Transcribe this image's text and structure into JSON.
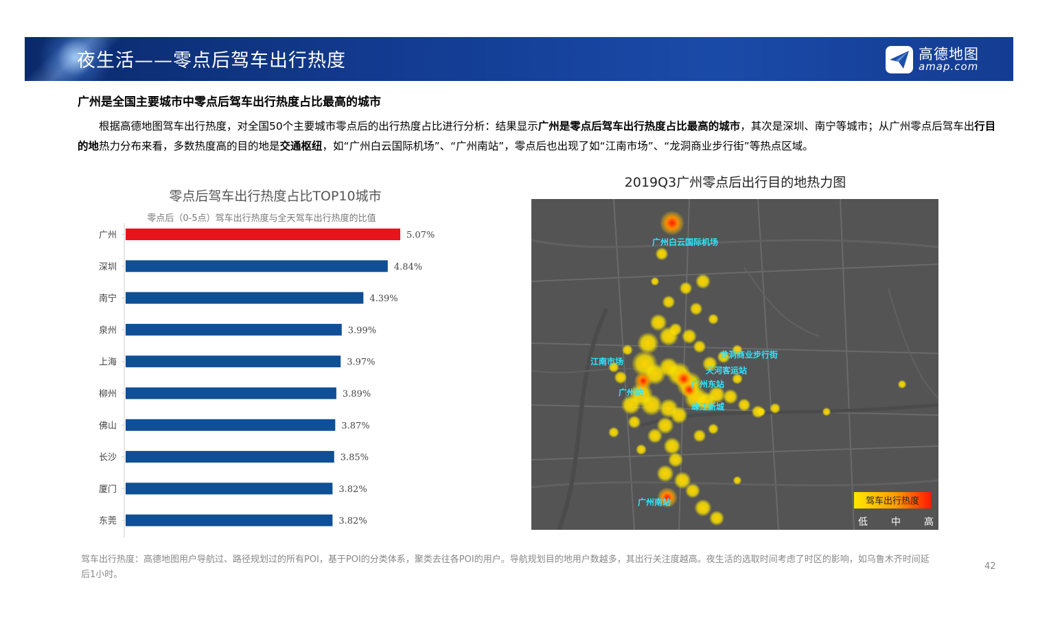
{
  "header": {
    "title": "夜生活——零点后驾车出行热度",
    "brand_cn": "高德地图",
    "brand_en": "amap.com"
  },
  "subheading": "广州是全国主要城市中零点后驾车出行热度占比最高的城市",
  "intro": {
    "p1": "根据高德地图驾车出行热度，对全国50个主要城市零点后的出行热度占比进行分析：结果显示",
    "b1": "广州是零点后驾车出行热度占比最高的城市",
    "p2": "，其次是深圳、南宁等城市；从广州零点后驾车出",
    "b2": "行目的地",
    "p3": "热力分布来看，多数热度高的目的地是",
    "b3": "交通枢纽",
    "p4": "，如“广州白云国际机场”、“广州南站”，零点后也出现了如“江南市场”、“龙洞商业步行街”等热点区域。"
  },
  "chart_data": {
    "type": "bar",
    "orientation": "horizontal",
    "title": "零点后驾车出行热度占比TOP10城市",
    "subtitle": "零点后（0-5点）驾车出行热度与全天驾车出行热度的比值",
    "categories": [
      "广州",
      "深圳",
      "南宁",
      "泉州",
      "上海",
      "柳州",
      "佛山",
      "长沙",
      "厦门",
      "东莞"
    ],
    "values": [
      5.07,
      4.84,
      4.39,
      3.99,
      3.97,
      3.89,
      3.87,
      3.85,
      3.82,
      3.82
    ],
    "value_labels": [
      "5.07%",
      "4.84%",
      "4.39%",
      "3.99%",
      "3.97%",
      "3.89%",
      "3.87%",
      "3.85%",
      "3.82%",
      "3.82%"
    ],
    "unit": "%",
    "colors": {
      "highlight": "#e8141b",
      "default": "#0f4f96",
      "axis": "#cccccc"
    },
    "highlight_index": 0
  },
  "map": {
    "title": "2019Q3广州零点后出行目的地热力图",
    "labels": [
      "广州白云国际机场",
      "江南市场",
      "龙洞商业步行街",
      "天河客运站",
      "广州东站",
      "广州站",
      "珠江新城",
      "广州南站"
    ],
    "legend": {
      "title": "驾车出行热度",
      "low": "低",
      "mid": "中",
      "high": "高"
    }
  },
  "footnote": "驾车出行热度：高德地图用户导航过、路径规划过的所有POI，基于POI的分类体系，聚类去往各POI的用户。导航规划目的地用户数越多，其出行关注度越高。夜生活的选取时间考虑了时区的影响，如乌鲁木齐时间延后1小时。",
  "page_number": "42"
}
